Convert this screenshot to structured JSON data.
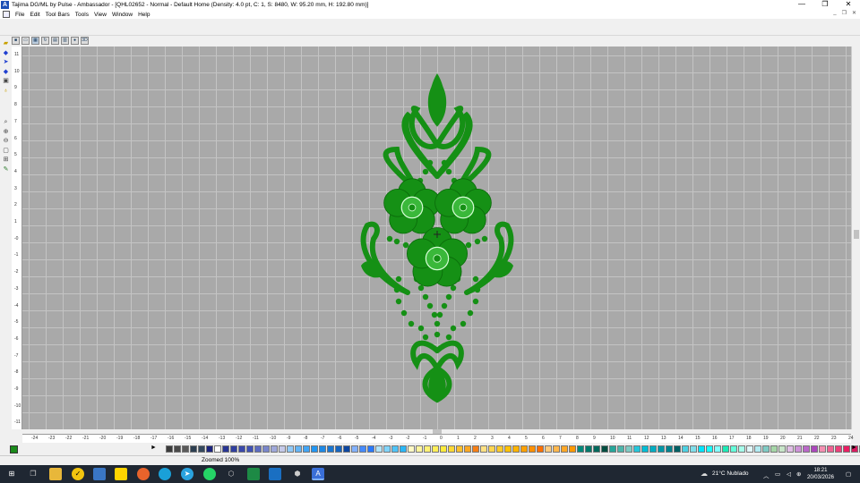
{
  "window": {
    "title": "Tajima DG/ML by Pulse - Ambassador - [QHL02652 - Normal - Default Home (Density: 4.0 pt, C: 1, S: 8480, W: 95.20 mm, H: 192.80 mm)]",
    "controls": [
      "—",
      "❐",
      "✕"
    ],
    "app_icon_letter": "A"
  },
  "menu": {
    "items": [
      "File",
      "Edit",
      "Tool Bars",
      "Tools",
      "View",
      "Window",
      "Help"
    ],
    "mdi_controls": [
      "_",
      "❐",
      "✕"
    ]
  },
  "viewbar": {
    "items": [
      "stop-icon",
      "monitor-icon",
      "grid-icon",
      "rotate-icon",
      "table-icon",
      "columns-icon",
      "sphere-icon",
      "3D"
    ]
  },
  "rulers": {
    "vertical": [
      "11",
      "10",
      "9",
      "8",
      "7",
      "6",
      "5",
      "4",
      "3",
      "2",
      "1",
      "-0",
      "-1",
      "-2",
      "-3",
      "-4",
      "-5",
      "-6",
      "-7",
      "-8",
      "-9",
      "-10",
      "-11"
    ],
    "horizontal": [
      "-24",
      "-23",
      "-22",
      "-21",
      "-20",
      "-19",
      "-18",
      "-17",
      "-16",
      "-15",
      "-14",
      "-13",
      "-12",
      "-11",
      "-10",
      "-9",
      "-8",
      "-7",
      "-6",
      "-5",
      "-4",
      "-3",
      "-2",
      "-1",
      "0",
      "1",
      "2",
      "3",
      "4",
      "5",
      "6",
      "7",
      "8",
      "9",
      "10",
      "11",
      "12",
      "13",
      "14",
      "15",
      "16",
      "17",
      "18",
      "19",
      "20",
      "21",
      "22",
      "23",
      "24"
    ]
  },
  "design": {
    "thread_color": "#159015",
    "highlight_color": "#3ab83a",
    "dark_color": "#0a6a0a"
  },
  "palette": {
    "colors": [
      "#3a3a3a",
      "#4a4a4a",
      "#5a5a5a",
      "#2c3e50",
      "#34495e",
      "#1a237e",
      "#ffffff",
      "#283593",
      "#303f9f",
      "#3949ab",
      "#3f51b5",
      "#5c6bc0",
      "#7986cb",
      "#9fa8da",
      "#c5cae9",
      "#90caf9",
      "#64b5f6",
      "#42a5f5",
      "#2196f3",
      "#1e88e5",
      "#1976d2",
      "#1565c0",
      "#0d47a1",
      "#82b1ff",
      "#448aff",
      "#2979ff",
      "#b3e5fc",
      "#81d4fa",
      "#4fc3f7",
      "#29b6f6",
      "#fff9c4",
      "#fff59d",
      "#fff176",
      "#ffee58",
      "#ffeb3b",
      "#fdd835",
      "#fbc02d",
      "#f9a825",
      "#f57f17",
      "#ffe082",
      "#ffd54f",
      "#ffca28",
      "#ffc107",
      "#ffb300",
      "#ffa000",
      "#ff8f00",
      "#ff6f00",
      "#ffcc80",
      "#ffb74d",
      "#ffa726",
      "#ff9800",
      "#00897b",
      "#00796b",
      "#00695c",
      "#004d40",
      "#26a69a",
      "#4db6ac",
      "#80cbc4",
      "#26c6da",
      "#00bcd4",
      "#00acc1",
      "#0097a7",
      "#00838f",
      "#006064",
      "#4dd0e1",
      "#80deea",
      "#00e5ff",
      "#18ffff",
      "#84ffff",
      "#1de9b6",
      "#64ffda",
      "#a7ffeb",
      "#e0f7fa",
      "#b2ebf2",
      "#80cbc4",
      "#a5d6a7",
      "#c8e6c9",
      "#e1bee7",
      "#ce93d8",
      "#ba68c8",
      "#ab47bc",
      "#f48fb1",
      "#f06292",
      "#ec407a",
      "#e91e63",
      "#d81b60",
      "#c2185b",
      "#ad1457",
      "#880e4f"
    ]
  },
  "status": {
    "zoom": "Zoomed 100%"
  },
  "taskbar": {
    "weather": "21°C  Nublado",
    "time": "18:21",
    "date": "20/03/2026",
    "icons": [
      "windows-start-icon",
      "task-view-icon",
      "file-explorer-icon",
      "norton-icon",
      "photos-icon",
      "sticky-notes-icon",
      "firefox-icon",
      "edge-icon",
      "telegram-icon",
      "whatsapp-icon",
      "3d-viewer-icon",
      "excel-icon",
      "outlook-icon",
      "embroidery-icon",
      "tajima-app-icon"
    ]
  }
}
